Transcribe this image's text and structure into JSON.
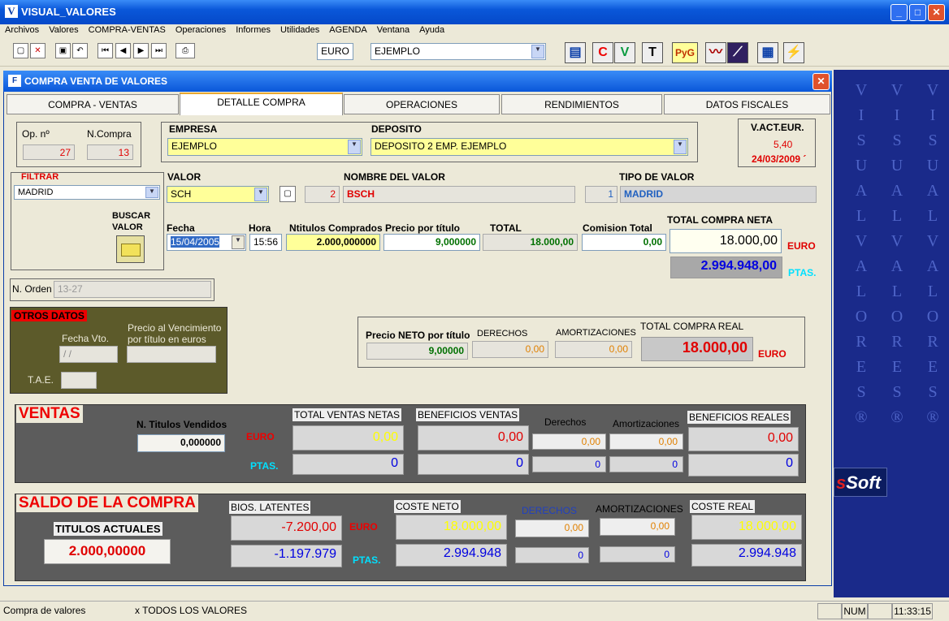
{
  "app": {
    "title": "VISUAL_VALORES",
    "icon_letter": "V"
  },
  "window_buttons": {
    "min": "_",
    "max": "□",
    "close": "✕"
  },
  "menu": [
    "Archivos",
    "Valores",
    "COMPRA-VENTAS",
    "Operaciones",
    "Informes",
    "Utilidades",
    "AGENDA",
    "Ventana",
    "Ayuda"
  ],
  "toolbar": {
    "currency": "EURO",
    "portfolio": "EJEMPLO",
    "icon_c": "C",
    "icon_v": "V",
    "icon_t": "T",
    "icon_pyg": "PyG"
  },
  "side": {
    "brand_s": "s",
    "brand_soft": "Soft",
    "vertical_text": "VISUALVALORES®"
  },
  "dialog": {
    "title": "COMPRA VENTA DE VALORES",
    "icon": "F"
  },
  "tabs": [
    "COMPRA - VENTAS",
    "DETALLE COMPRA",
    "OPERACIONES",
    "RENDIMIENTOS",
    "DATOS FISCALES"
  ],
  "op": {
    "op_label": "Op. nº",
    "op_value": "27",
    "ncompra_label": "N.Compra",
    "ncompra_value": "13"
  },
  "empresa": {
    "label": "EMPRESA",
    "value": "EJEMPLO"
  },
  "deposito": {
    "label": "DEPOSITO",
    "value": "DEPOSITO 2 EMP. EJEMPLO"
  },
  "vact": {
    "label": "V.ACT.EUR.",
    "value": "5,40",
    "date": "24/03/2009 ´"
  },
  "filtrar": {
    "label": "FILTRAR",
    "value": "MADRID",
    "buscar": "BUSCAR VALOR"
  },
  "valor": {
    "label": "VALOR",
    "value": "SCH",
    "num": "2",
    "nombre_label": "NOMBRE DEL VALOR",
    "nombre": "BSCH",
    "tipo_label": "TIPO DE VALOR",
    "tipo_num": "1",
    "tipo": "MADRID"
  },
  "compra": {
    "fecha_label": "Fecha",
    "fecha": "15/04/2005",
    "hora_label": "Hora",
    "hora": "15:56",
    "ntitulos_label": "Ntitulos Comprados",
    "ntitulos": "2.000,000000",
    "precio_label": "Precio  por título",
    "precio": "9,000000",
    "total_label": "TOTAL",
    "total": "18.000,00",
    "comision_label": "Comision Total",
    "comision": "0,00",
    "neta_label": "TOTAL COMPRA NETA",
    "neta_eur": "18.000,00",
    "neta_ptas": "2.994.948,00",
    "euro": "EURO",
    "ptas": "PTAS."
  },
  "norden": {
    "label": "N. Orden",
    "value": "13-27"
  },
  "otros": {
    "title": "OTROS DATOS",
    "fecha_vto": "Fecha Vto.",
    "fecha_vto_value": " / /",
    "precio_venc": "Precio al Vencimiento por título en euros",
    "tae": "T.A.E."
  },
  "neto": {
    "precio_label": "Precio NETO por título",
    "precio": "9,00000",
    "derechos_label": "DERECHOS",
    "derechos": "0,00",
    "amort_label": "AMORTIZACIONES",
    "amort": "0,00",
    "real_label": "TOTAL COMPRA REAL",
    "real": "18.000,00",
    "euro": "EURO"
  },
  "ventas": {
    "title": "VENTAS",
    "ntit_label": "N. Titulos Vendidos",
    "ntit": "0,000000",
    "euro": "EURO",
    "ptas": "PTAS.",
    "total_label": "TOTAL VENTAS NETAS",
    "total_eur": "0,00",
    "total_ptas": "0",
    "benef_label": "BENEFICIOS VENTAS",
    "benef_eur": "0,00",
    "benef_ptas": "0",
    "der_label": "Derechos",
    "der_eur": "0,00",
    "der_ptas": "0",
    "amort_label": "Amortizaciones",
    "amort_eur": "0,00",
    "amort_ptas": "0",
    "real_label": "BENEFICIOS REALES",
    "real_eur": "0,00",
    "real_ptas": "0"
  },
  "saldo": {
    "title": "SALDO DE LA COMPRA",
    "tit_label": "TITULOS ACTUALES",
    "tit": "2.000,00000",
    "euro": "EURO",
    "ptas": "PTAS.",
    "bios_label": "BIOS. LATENTES",
    "bios_eur": "-7.200,00",
    "bios_ptas": "-1.197.979",
    "coste_label": "COSTE NETO",
    "coste_eur": "18.000,00",
    "coste_ptas": "2.994.948",
    "der_label": "DERECHOS",
    "der_eur": "0,00",
    "der_ptas": "0",
    "amort_label": "AMORTIZACIONES",
    "amort_eur": "0,00",
    "amort_ptas": "0",
    "real_label": "COSTE REAL",
    "real_eur": "18.000,00",
    "real_ptas": "2.994.948"
  },
  "status": {
    "left": "Compra de valores",
    "mid": "x  TODOS LOS VALORES",
    "num": "NUM",
    "time": "11:33:15"
  }
}
